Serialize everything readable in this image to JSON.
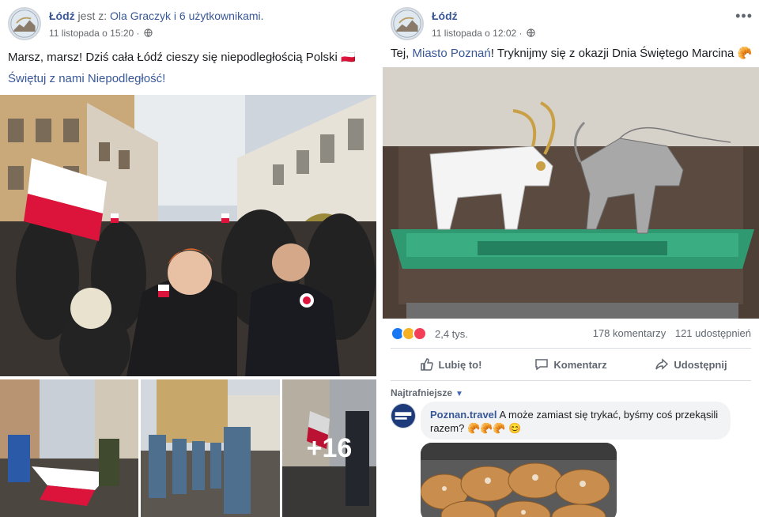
{
  "left_post": {
    "page_name": "Łódź",
    "with_text": "jest z:",
    "tagged": "Ola Graczyk i 6 użytkownikami.",
    "timestamp": "11 listopada o 15:20",
    "separator": "·",
    "text": "Marsz, marsz! Dziś cała Łódź cieszy się niepodległością Polski 🇵🇱",
    "hashtag_link": "Świętuj z nami Niepodległość!",
    "more_photos": "+16"
  },
  "right_post": {
    "page_name": "Łódź",
    "timestamp": "11 listopada o 12:02",
    "separator": "·",
    "more_menu": "•••",
    "text_before": "Tej,",
    "mention": "Miasto Poznań",
    "text_after": "! Tryknijmy się z okazji Dnia Świętego Marcina 🥐",
    "reactions_count": "2,4 tys.",
    "comments_count": "178 komentarzy",
    "shares_count": "121 udostępnień",
    "actions": {
      "like": "Lubię to!",
      "comment": "Komentarz",
      "share": "Udostępnij"
    },
    "sort_label": "Najtrafniejsze",
    "sort_caret": "▼",
    "comment": {
      "author": "Poznan.travel",
      "text": "A może zamiast się trykać, byśmy coś przekąsili razem? 🥐🥐🥐 😊"
    }
  },
  "colors": {
    "link": "#385898",
    "muted": "#65676b",
    "like_blue": "#1877f2",
    "love_red": "#f33e58",
    "haha_yellow": "#f7b125"
  }
}
